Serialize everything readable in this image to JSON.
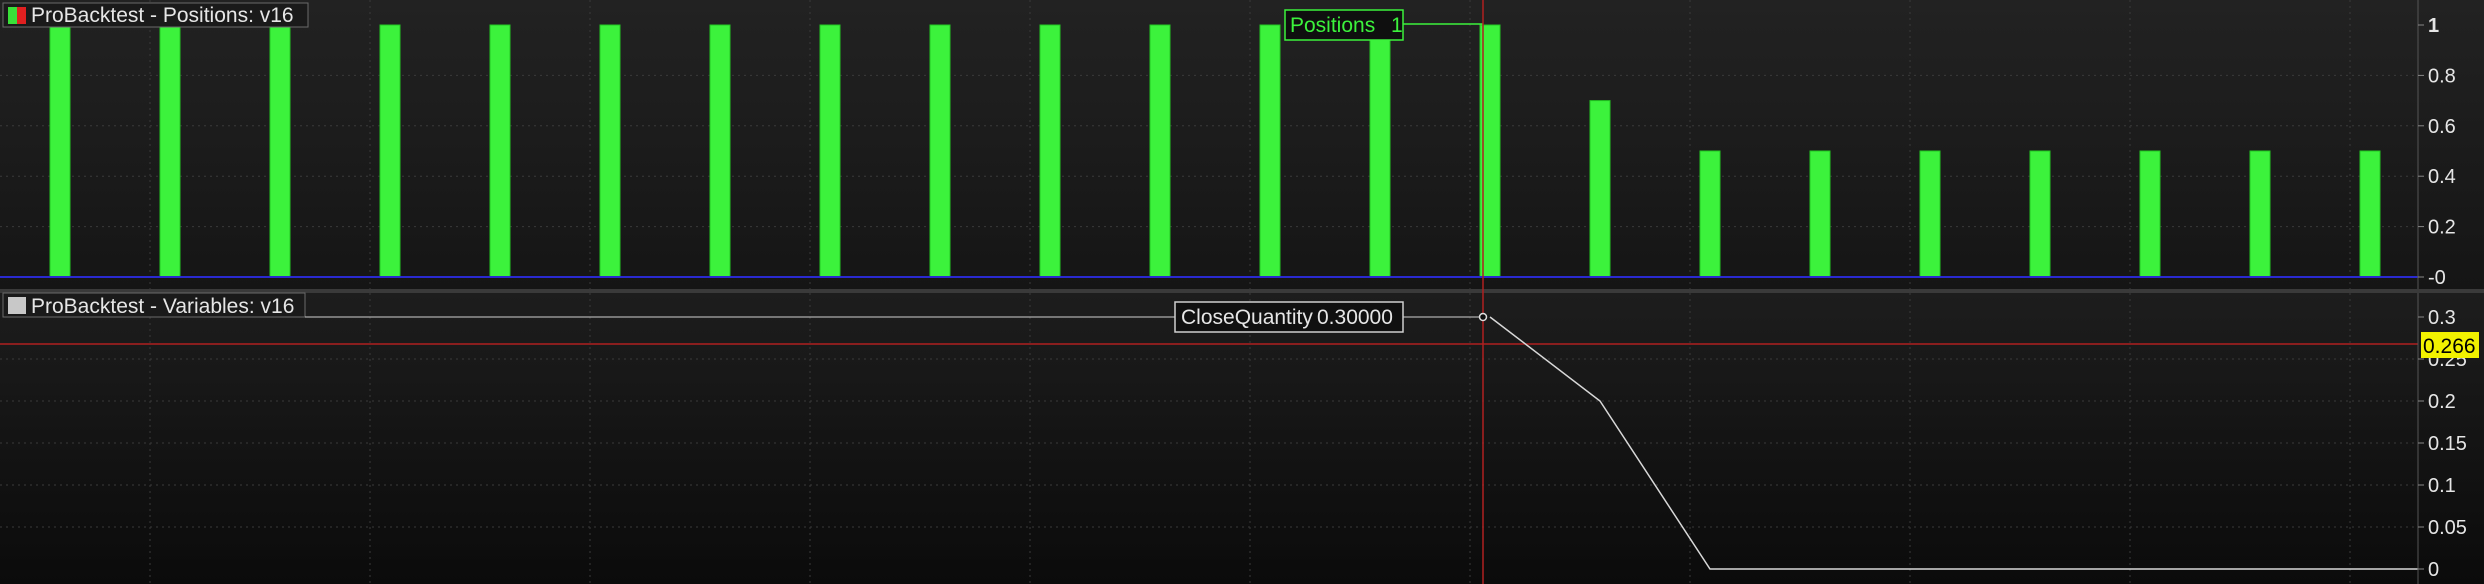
{
  "colors": {
    "background": "#0f0f0f",
    "grid": "#3a3a3a",
    "bar": "#3cf23c",
    "bar_edge": "#22c822",
    "zero_line": "#2a2ad0",
    "crosshair": "#b02020",
    "price_tag": "#f2f200",
    "line": "#d8d8d8",
    "text": "#e6e6e6"
  },
  "panels": {
    "positions": {
      "title": "ProBacktest - Positions: v16",
      "tooltip_label": "Positions",
      "tooltip_value": "1",
      "icon": "red-green-square-icon"
    },
    "variables": {
      "title": "ProBacktest - Variables: v16",
      "tooltip_label": "CloseQuantity",
      "tooltip_value": "0.30000",
      "price_tag": "0.266",
      "icon": "grey-square-icon"
    }
  },
  "chart_data": [
    {
      "type": "bar",
      "title": "ProBacktest - Positions: v16",
      "series": [
        {
          "name": "Positions",
          "values": [
            1,
            1,
            1,
            1,
            1,
            1,
            1,
            1,
            1,
            1,
            1,
            1,
            1,
            1,
            0.7,
            0.5,
            0.5,
            0.5,
            0.5,
            0.5,
            0.5,
            0.5
          ]
        }
      ],
      "ylim": [
        0,
        1
      ],
      "yticks": [
        "1",
        "0.8",
        "0.6",
        "0.4",
        "0.2",
        "-0"
      ],
      "grid": true
    },
    {
      "type": "line",
      "title": "ProBacktest - Variables: v16",
      "series": [
        {
          "name": "CloseQuantity",
          "values": [
            0.3,
            0.3,
            0.3,
            0.3,
            0.3,
            0.3,
            0.3,
            0.3,
            0.3,
            0.3,
            0.3,
            0.3,
            0.3,
            0.3,
            0.2,
            0,
            0,
            0,
            0,
            0,
            0,
            0
          ]
        }
      ],
      "ylim": [
        0,
        0.3
      ],
      "yticks": [
        "0.3",
        "0.25",
        "0.2",
        "0.15",
        "0.1",
        "0.05",
        "0"
      ],
      "grid": true
    }
  ]
}
